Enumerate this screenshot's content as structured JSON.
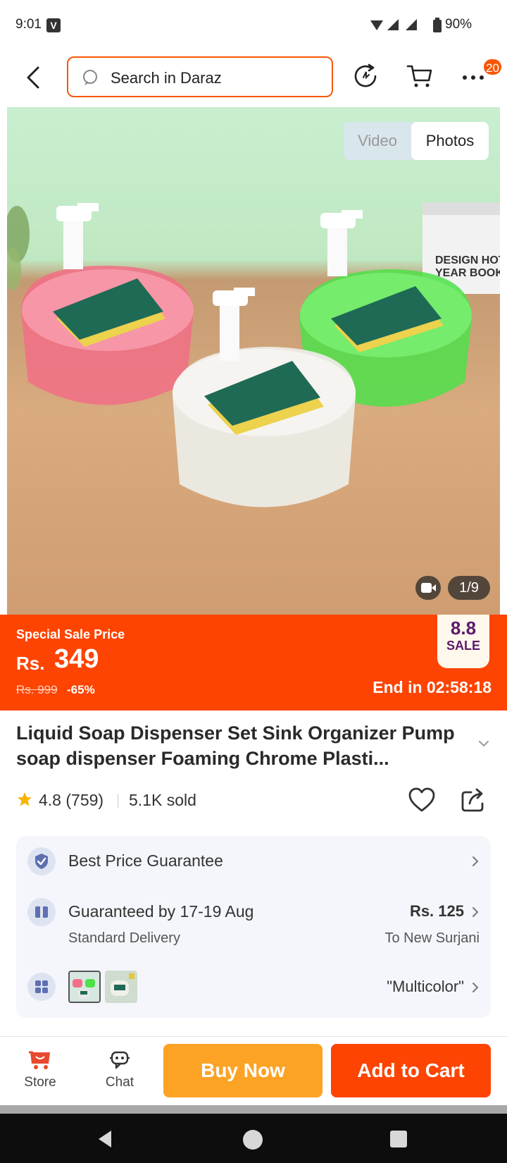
{
  "status_bar": {
    "time": "9:01",
    "notification_icon": "V",
    "battery": "90%"
  },
  "header": {
    "search_placeholder": "Search in Daraz",
    "cart_badge": "20",
    "accent": "#f85606"
  },
  "gallery": {
    "tab_video": "Video",
    "tab_photos": "Photos",
    "selected_tab": "Photos",
    "counter": "1/9",
    "book_text": [
      "DESIGN HOT",
      "YEAR BOOK"
    ]
  },
  "sale": {
    "label": "Special Sale Price",
    "currency": "Rs.",
    "price": "349",
    "original_price": "Rs. 999",
    "discount": "-65%",
    "logo_number": "8.8",
    "logo_word": "SALE",
    "countdown": "End in 02:58:18",
    "color": "#fd4402"
  },
  "product": {
    "title": "Liquid Soap Dispenser Set Sink Organizer Pump soap dispenser Foaming Chrome Plasti...",
    "rating": "4.8",
    "reviews": "(759)",
    "sold": "5.1K sold"
  },
  "info": {
    "best_price": "Best Price Guarantee",
    "delivery_title": "Guaranteed by 17-19 Aug",
    "delivery_price": "Rs. 125",
    "delivery_type": "Standard Delivery",
    "delivery_to": "To New Surjani",
    "variant": "\"Multicolor\""
  },
  "bottom_bar": {
    "store": "Store",
    "chat": "Chat",
    "buy_now": "Buy Now",
    "add_to_cart": "Add to Cart",
    "buy_color": "#fca326",
    "cart_color": "#fd4402"
  }
}
